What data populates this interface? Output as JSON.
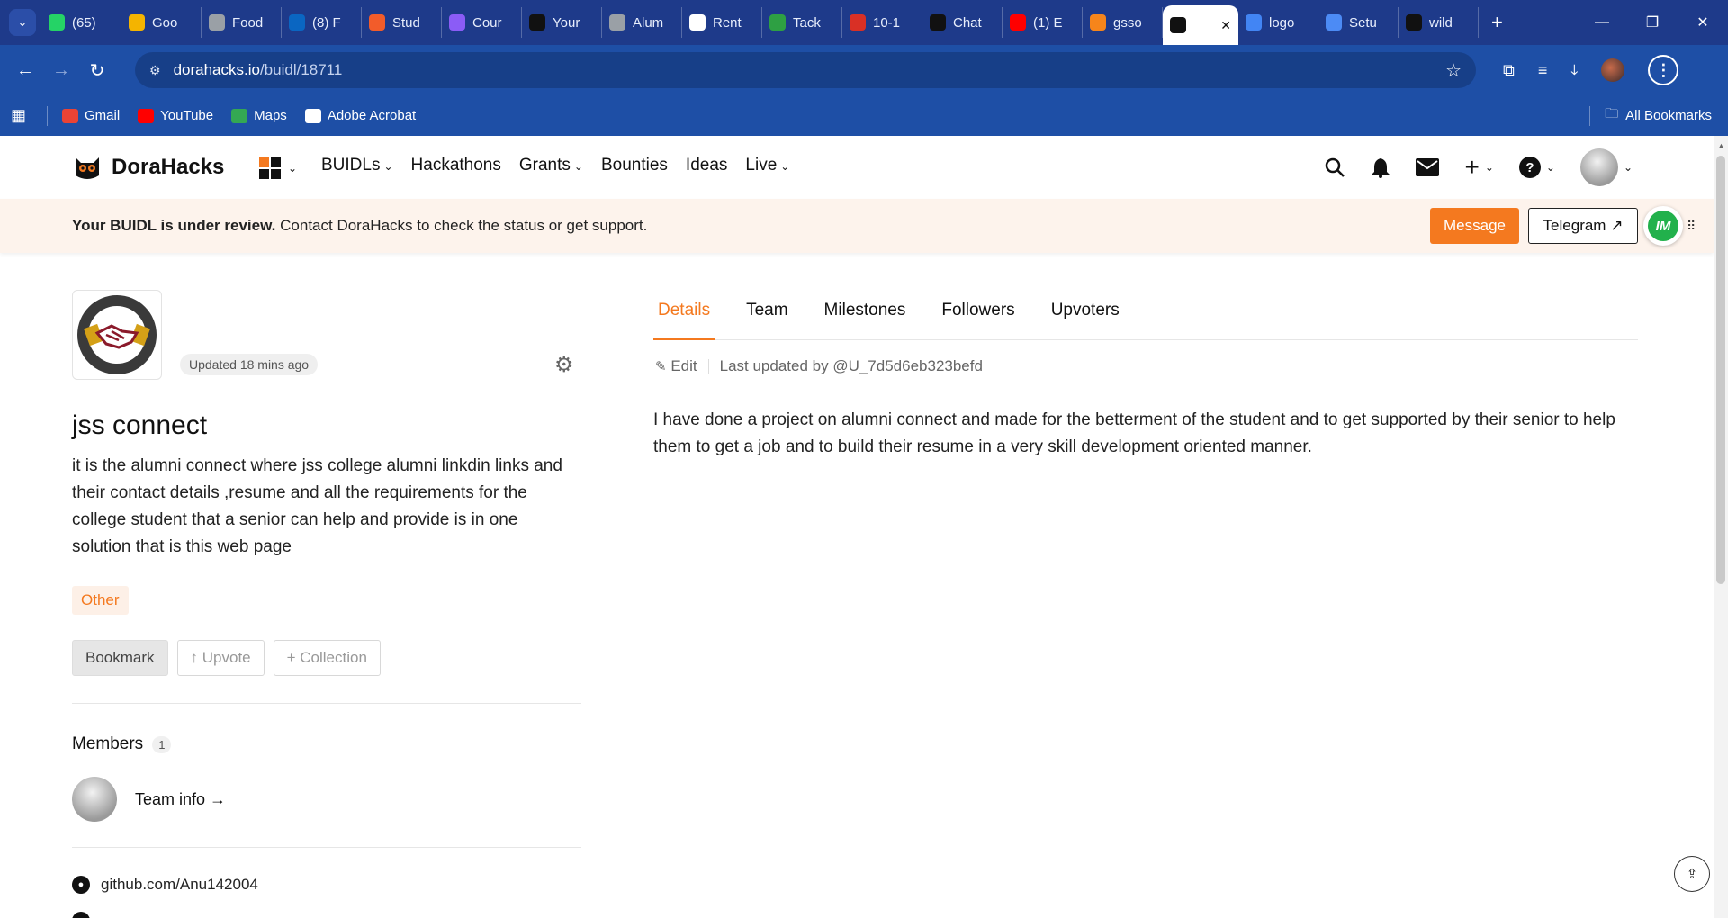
{
  "browser": {
    "tabs": [
      {
        "label": "(65)",
        "icon": "whatsapp-icon",
        "color": "#25d366"
      },
      {
        "label": "Goo",
        "icon": "google-drive-icon",
        "color": "#f4b400"
      },
      {
        "label": "Food",
        "icon": "globe-icon",
        "color": "#9aa0a6"
      },
      {
        "label": "(8) F",
        "icon": "linkedin-icon",
        "color": "#0a66c2"
      },
      {
        "label": "Stud",
        "icon": "studio-icon",
        "color": "#f25c2a"
      },
      {
        "label": "Cour",
        "icon": "course-icon",
        "color": "#8b5cf6"
      },
      {
        "label": "Your",
        "icon": "github-icon",
        "color": "#111111"
      },
      {
        "label": "Alum",
        "icon": "globe-icon",
        "color": "#9aa0a6"
      },
      {
        "label": "Rent",
        "icon": "doc-icon",
        "color": "#ffffff"
      },
      {
        "label": "Tack",
        "icon": "tack-icon",
        "color": "#2ea043"
      },
      {
        "label": "10-1",
        "icon": "pdf-icon",
        "color": "#d93025"
      },
      {
        "label": "Chat",
        "icon": "chatgpt-icon",
        "color": "#111111"
      },
      {
        "label": "(1) E",
        "icon": "youtube-icon",
        "color": "#ff0000"
      },
      {
        "label": "gsso",
        "icon": "metamask-icon",
        "color": "#f6851b"
      },
      {
        "label": "",
        "icon": "dorahacks-icon",
        "color": "#111111",
        "active": true
      },
      {
        "label": "logo",
        "icon": "google-icon",
        "color": "#4285f4"
      },
      {
        "label": "Setu",
        "icon": "shield-icon",
        "color": "#4c8bf5"
      },
      {
        "label": "wild",
        "icon": "wix-icon",
        "color": "#111111"
      }
    ],
    "url_host": "dorahacks.io",
    "url_path": "/buidl/18711",
    "bookmarks": [
      {
        "label": "Gmail",
        "color": "#ea4335"
      },
      {
        "label": "YouTube",
        "color": "#ff0000"
      },
      {
        "label": "Maps",
        "color": "#34a853"
      },
      {
        "label": "Adobe Acrobat",
        "color": "#ffffff"
      }
    ],
    "all_bookmarks": "All Bookmarks"
  },
  "header": {
    "brand": "DoraHacks",
    "nav": [
      {
        "label": "BUIDLs",
        "dropdown": true
      },
      {
        "label": "Hackathons",
        "dropdown": false
      },
      {
        "label": "Grants",
        "dropdown": true
      },
      {
        "label": "Bounties",
        "dropdown": false
      },
      {
        "label": "Ideas",
        "dropdown": false
      },
      {
        "label": "Live",
        "dropdown": true
      }
    ]
  },
  "review": {
    "bold": "Your BUIDL is under review.",
    "text": "Contact DoraHacks to check the status or get support.",
    "message_btn": "Message",
    "telegram_btn": "Telegram ↗",
    "im_badge": "IM"
  },
  "project": {
    "updated": "Updated 18 mins ago",
    "title": "jss connect",
    "description": "it is the alumni connect where jss college alumni linkdin links and their contact details ,resume and all the requirements for the college student that a senior can help and provide is in one solution that is this web page",
    "tag": "Other",
    "bookmark": "Bookmark",
    "upvote": "↑ Upvote",
    "collection": "+ Collection",
    "members_label": "Members",
    "members_count": "1",
    "team_info": "Team info →",
    "github": "github.com/Anu142004"
  },
  "details": {
    "tabs": [
      "Details",
      "Team",
      "Milestones",
      "Followers",
      "Upvoters"
    ],
    "active_tab": "Details",
    "edit": "Edit",
    "last_updated": "Last updated by @U_7d5d6eb323befd",
    "body": "I have done a project on alumni connect and made for the betterment of the student and to get supported by their senior to help them to get a job and to build their resume in a very skill development oriented manner."
  },
  "colors": {
    "accent": "#f4791f",
    "chrome": "#1e4fa6"
  }
}
